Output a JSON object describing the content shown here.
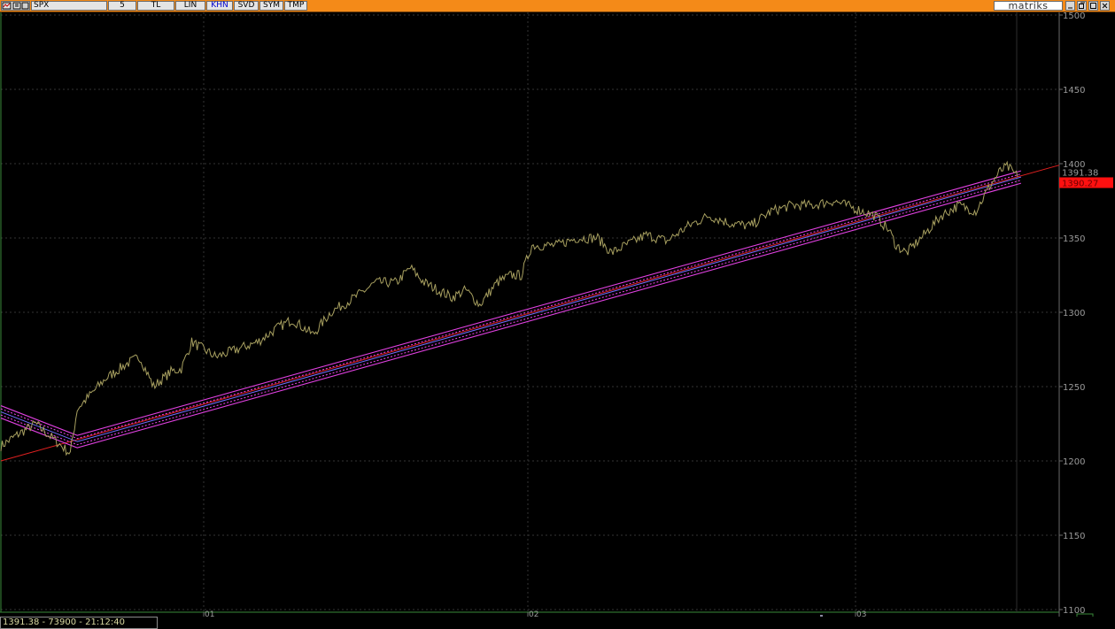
{
  "toolbar": {
    "symbol": "SPX",
    "buttons": [
      {
        "label": "5",
        "selected": false
      },
      {
        "label": "TL",
        "selected": false
      },
      {
        "label": "LIN",
        "selected": false
      },
      {
        "label": "KHN",
        "selected": true
      },
      {
        "label": "SVD",
        "selected": false
      },
      {
        "label": "SYM",
        "selected": false
      },
      {
        "label": "TMP",
        "selected": false
      }
    ],
    "brand": "matriks"
  },
  "status": {
    "text": "1391.38 - 73900 - 21:12:40"
  },
  "colors": {
    "toolbar_bg": "#f48a18",
    "price_line": "#a8a060",
    "channel": "#e040e0",
    "channel_center": "#7070ff",
    "trend": "#e02020",
    "grid": "#333333",
    "last_price_box": "#ff1010"
  },
  "chart_data": {
    "type": "line",
    "symbol": "SPX",
    "ylim": [
      1100,
      1500
    ],
    "y_ticks": [
      1500,
      1450,
      1400,
      1350,
      1300,
      1250,
      1200,
      1150,
      1100
    ],
    "x_ticks": [
      "01",
      "02",
      "03"
    ],
    "last_price": 1391.38,
    "last_price_label": "1391.38",
    "channel_price_label": "1390.27",
    "price_series_anchors": [
      {
        "x": 0,
        "y": 1210
      },
      {
        "x": 0.5,
        "y": 1218
      },
      {
        "x": 1.0,
        "y": 1225
      },
      {
        "x": 1.5,
        "y": 1215
      },
      {
        "x": 2.0,
        "y": 1205
      },
      {
        "x": 2.2,
        "y": 1235
      },
      {
        "x": 2.6,
        "y": 1245
      },
      {
        "x": 3.0,
        "y": 1255
      },
      {
        "x": 3.6,
        "y": 1265
      },
      {
        "x": 4.0,
        "y": 1270
      },
      {
        "x": 4.4,
        "y": 1250
      },
      {
        "x": 4.9,
        "y": 1260
      },
      {
        "x": 5.2,
        "y": 1262
      },
      {
        "x": 5.5,
        "y": 1280
      },
      {
        "x": 6.2,
        "y": 1270
      },
      {
        "x": 6.8,
        "y": 1275
      },
      {
        "x": 7.4,
        "y": 1280
      },
      {
        "x": 8.0,
        "y": 1290
      },
      {
        "x": 8.4,
        "y": 1295
      },
      {
        "x": 9.0,
        "y": 1285
      },
      {
        "x": 9.5,
        "y": 1300
      },
      {
        "x": 10.2,
        "y": 1310
      },
      {
        "x": 10.8,
        "y": 1320
      },
      {
        "x": 11.4,
        "y": 1320
      },
      {
        "x": 11.8,
        "y": 1330
      },
      {
        "x": 12.2,
        "y": 1320
      },
      {
        "x": 12.6,
        "y": 1315
      },
      {
        "x": 13.0,
        "y": 1310
      },
      {
        "x": 13.4,
        "y": 1315
      },
      {
        "x": 13.8,
        "y": 1305
      },
      {
        "x": 14.3,
        "y": 1320
      },
      {
        "x": 14.7,
        "y": 1325
      },
      {
        "x": 15.0,
        "y": 1325
      },
      {
        "x": 15.3,
        "y": 1345
      },
      {
        "x": 16.0,
        "y": 1345
      },
      {
        "x": 16.6,
        "y": 1350
      },
      {
        "x": 17.2,
        "y": 1350
      },
      {
        "x": 17.6,
        "y": 1340
      },
      {
        "x": 18.0,
        "y": 1345
      },
      {
        "x": 18.6,
        "y": 1352
      },
      {
        "x": 19.2,
        "y": 1348
      },
      {
        "x": 19.8,
        "y": 1358
      },
      {
        "x": 20.4,
        "y": 1365
      },
      {
        "x": 21.0,
        "y": 1360
      },
      {
        "x": 21.6,
        "y": 1358
      },
      {
        "x": 22.2,
        "y": 1368
      },
      {
        "x": 22.8,
        "y": 1372
      },
      {
        "x": 23.4,
        "y": 1372
      },
      {
        "x": 24.0,
        "y": 1375
      },
      {
        "x": 24.6,
        "y": 1370
      },
      {
        "x": 25.2,
        "y": 1365
      },
      {
        "x": 25.6,
        "y": 1355
      },
      {
        "x": 25.8,
        "y": 1345
      },
      {
        "x": 26.1,
        "y": 1340
      },
      {
        "x": 26.6,
        "y": 1352
      },
      {
        "x": 27.1,
        "y": 1365
      },
      {
        "x": 27.6,
        "y": 1372
      },
      {
        "x": 28.1,
        "y": 1368
      },
      {
        "x": 28.5,
        "y": 1385
      },
      {
        "x": 28.8,
        "y": 1395
      },
      {
        "x": 29.0,
        "y": 1398
      },
      {
        "x": 29.3,
        "y": 1391.38
      }
    ],
    "channel": {
      "left_start": {
        "x": 0,
        "y": 1233
      },
      "pivot": {
        "x": 2.2,
        "y": 1213
      },
      "right_end": {
        "x": 29.4,
        "y": 1391
      }
    },
    "trendline": {
      "start": {
        "x": 0,
        "y": 1200
      },
      "end": {
        "x": 30.5,
        "y": 1399
      }
    }
  }
}
